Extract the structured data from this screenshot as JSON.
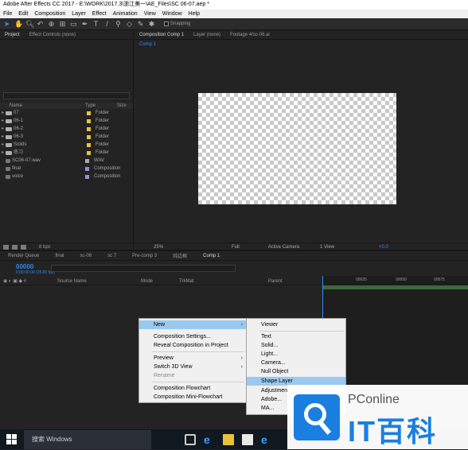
{
  "window": {
    "title": "Adobe After Effects CC 2017 - E:\\WORK\\2017.3\\浙江美一\\AE_Files\\SC 06-07.aep *"
  },
  "menubar": [
    "File",
    "Edit",
    "Composition",
    "Layer",
    "Effect",
    "Animation",
    "View",
    "Window",
    "Help"
  ],
  "toolbar": {
    "snapping_label": "Snapping"
  },
  "project_panel": {
    "tab_label": "Project",
    "effect_controls_label": "Effect Controls (none)",
    "col_name": "Name",
    "col_type": "Type",
    "col_size": "Size",
    "items": [
      {
        "name": "07",
        "type": "Folder",
        "color": "#e8c23a",
        "kind": "folder"
      },
      {
        "name": "06-1",
        "type": "Folder",
        "color": "#e8c23a",
        "kind": "folder"
      },
      {
        "name": "06-2",
        "type": "Folder",
        "color": "#e8c23a",
        "kind": "folder"
      },
      {
        "name": "06-3",
        "type": "Folder",
        "color": "#e8c23a",
        "kind": "folder"
      },
      {
        "name": "Solids",
        "type": "Folder",
        "color": "#e8c23a",
        "kind": "folder"
      },
      {
        "name": "练习",
        "type": "Folder",
        "color": "#e8c23a",
        "kind": "folder"
      },
      {
        "name": "SC06-07.wav",
        "type": "WAV",
        "color": "#aaaaaa",
        "kind": "file"
      },
      {
        "name": "final",
        "type": "Composition",
        "color": "#9a8fd4",
        "kind": "file"
      },
      {
        "name": "voice",
        "type": "Composition",
        "color": "#9a8fd4",
        "kind": "file"
      }
    ],
    "bottom_bpc": "8 bpc"
  },
  "viewer": {
    "tabs": [
      "Composition Comp 1",
      "Layer (none)",
      "Footage 4/sc-06.ai"
    ],
    "sub_tab": "Comp 1",
    "zoom": "25%",
    "resolution": "Full",
    "camera": "Active Camera",
    "views": "1 View",
    "exposure": "+0.0"
  },
  "timeline": {
    "tabs": [
      "Render Queue",
      "final",
      "sc-06",
      "sc 7",
      "Pre-comp 3",
      "纯边框",
      "Comp 1"
    ],
    "timecode": "00000",
    "fps": "0:00:00:00 (25.00 fps)",
    "col_source": "Source Name",
    "col_mode": "Mode",
    "col_trkmat": "TrkMat",
    "col_parent": "Parent",
    "ruler_ticks": [
      "00025",
      "00050",
      "00075"
    ]
  },
  "context_menu": {
    "items": [
      {
        "label": "New",
        "submenu": true,
        "highlight": true
      },
      {
        "label": "Composition Settings..."
      },
      {
        "label": "Reveal Composition in Project"
      },
      {
        "label": "Preview",
        "submenu": true
      },
      {
        "label": "Switch 3D View",
        "submenu": true
      },
      {
        "label": "Rename",
        "disabled": true
      },
      {
        "label": "Composition Flowchart"
      },
      {
        "label": "Composition Mini-Flowchart"
      }
    ]
  },
  "submenu": {
    "items": [
      "Viewer",
      "Text",
      "Solid...",
      "Light...",
      "Camera...",
      "Null Object",
      "Shape Layer",
      "Adjustment Layer",
      "Adobe...",
      "MA..."
    ]
  },
  "taskbar": {
    "search_text": "搜索 Windows"
  },
  "watermark": {
    "brand": "PConline",
    "cn": "IT百科"
  }
}
